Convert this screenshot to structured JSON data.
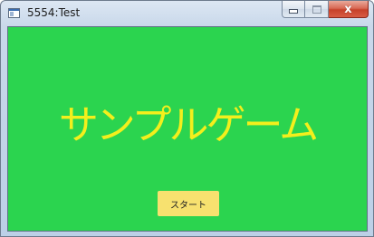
{
  "window": {
    "title": "5554:Test",
    "icon": "app-window-icon",
    "controls": {
      "minimize_icon": "minimize-icon",
      "maximize_icon": "maximize-icon",
      "close_glyph": "x"
    }
  },
  "game": {
    "title": "サンプルゲーム",
    "start_label": "スタート"
  },
  "colors": {
    "background": "#2bd44f",
    "title_text": "#f3ef1c",
    "button": "#f7e16f",
    "close_button": "#c7412a"
  }
}
